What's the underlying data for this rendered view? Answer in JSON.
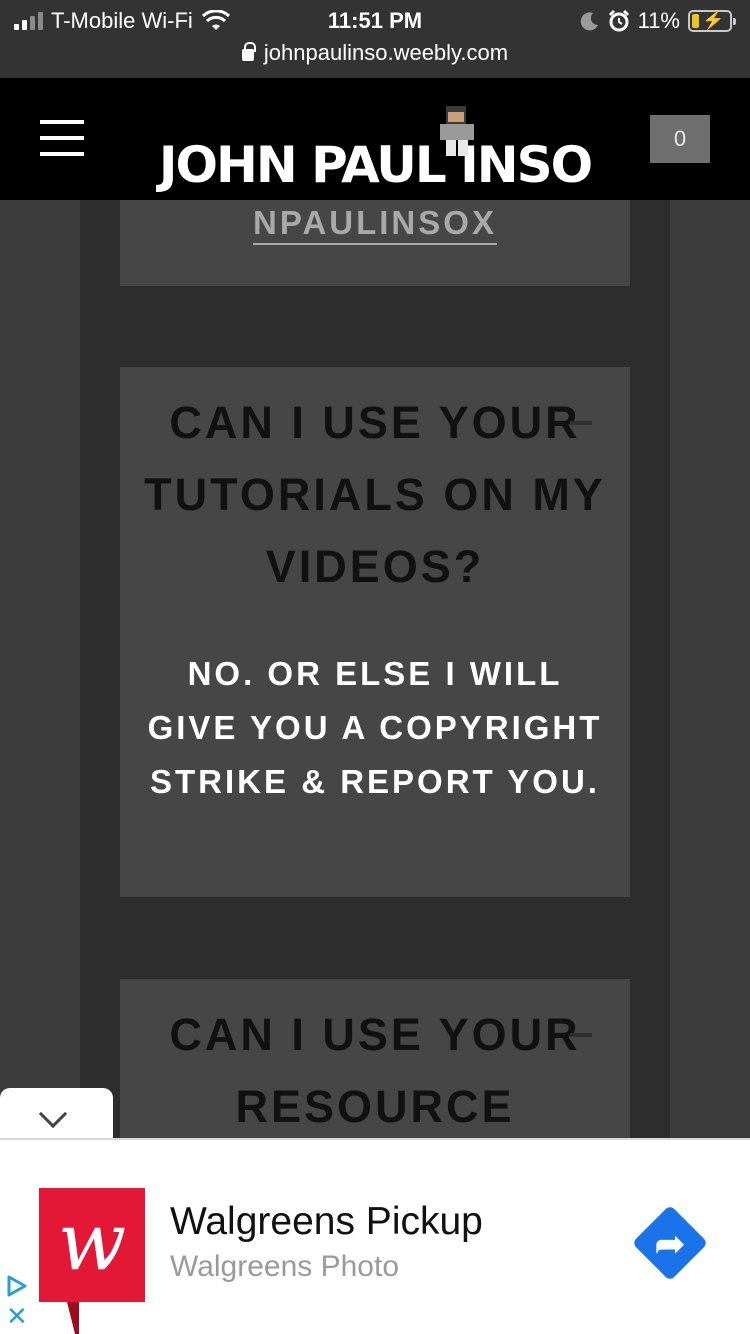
{
  "status_bar": {
    "carrier": "T-Mobile Wi-Fi",
    "time": "11:51 PM",
    "battery": "11%",
    "url": "johnpaulinso.weebly.com"
  },
  "header": {
    "logo": "JOHN PAUL INSO",
    "cart_count": "0"
  },
  "content": {
    "top_link": "NPAULINSOX",
    "faq": [
      {
        "question": "CAN I USE YOUR TUTORIALS ON MY VIDEOS?",
        "answer": "NO. OR ELSE I WILL GIVE YOU A COPYRIGHT STRIKE & REPORT YOU."
      },
      {
        "question": "CAN I USE YOUR RESOURCE"
      }
    ]
  },
  "ad": {
    "logo_letter": "w",
    "title": "Walgreens Pickup",
    "subtitle": "Walgreens Photo",
    "close_glyph": "✕"
  },
  "colors": {
    "page_bg": "#3b3b3b",
    "column_bg": "#2d2d2d",
    "card_bg": "#464646",
    "header_bg": "#000000",
    "walgreens_red": "#e31837",
    "directions_blue": "#1a73e8"
  }
}
